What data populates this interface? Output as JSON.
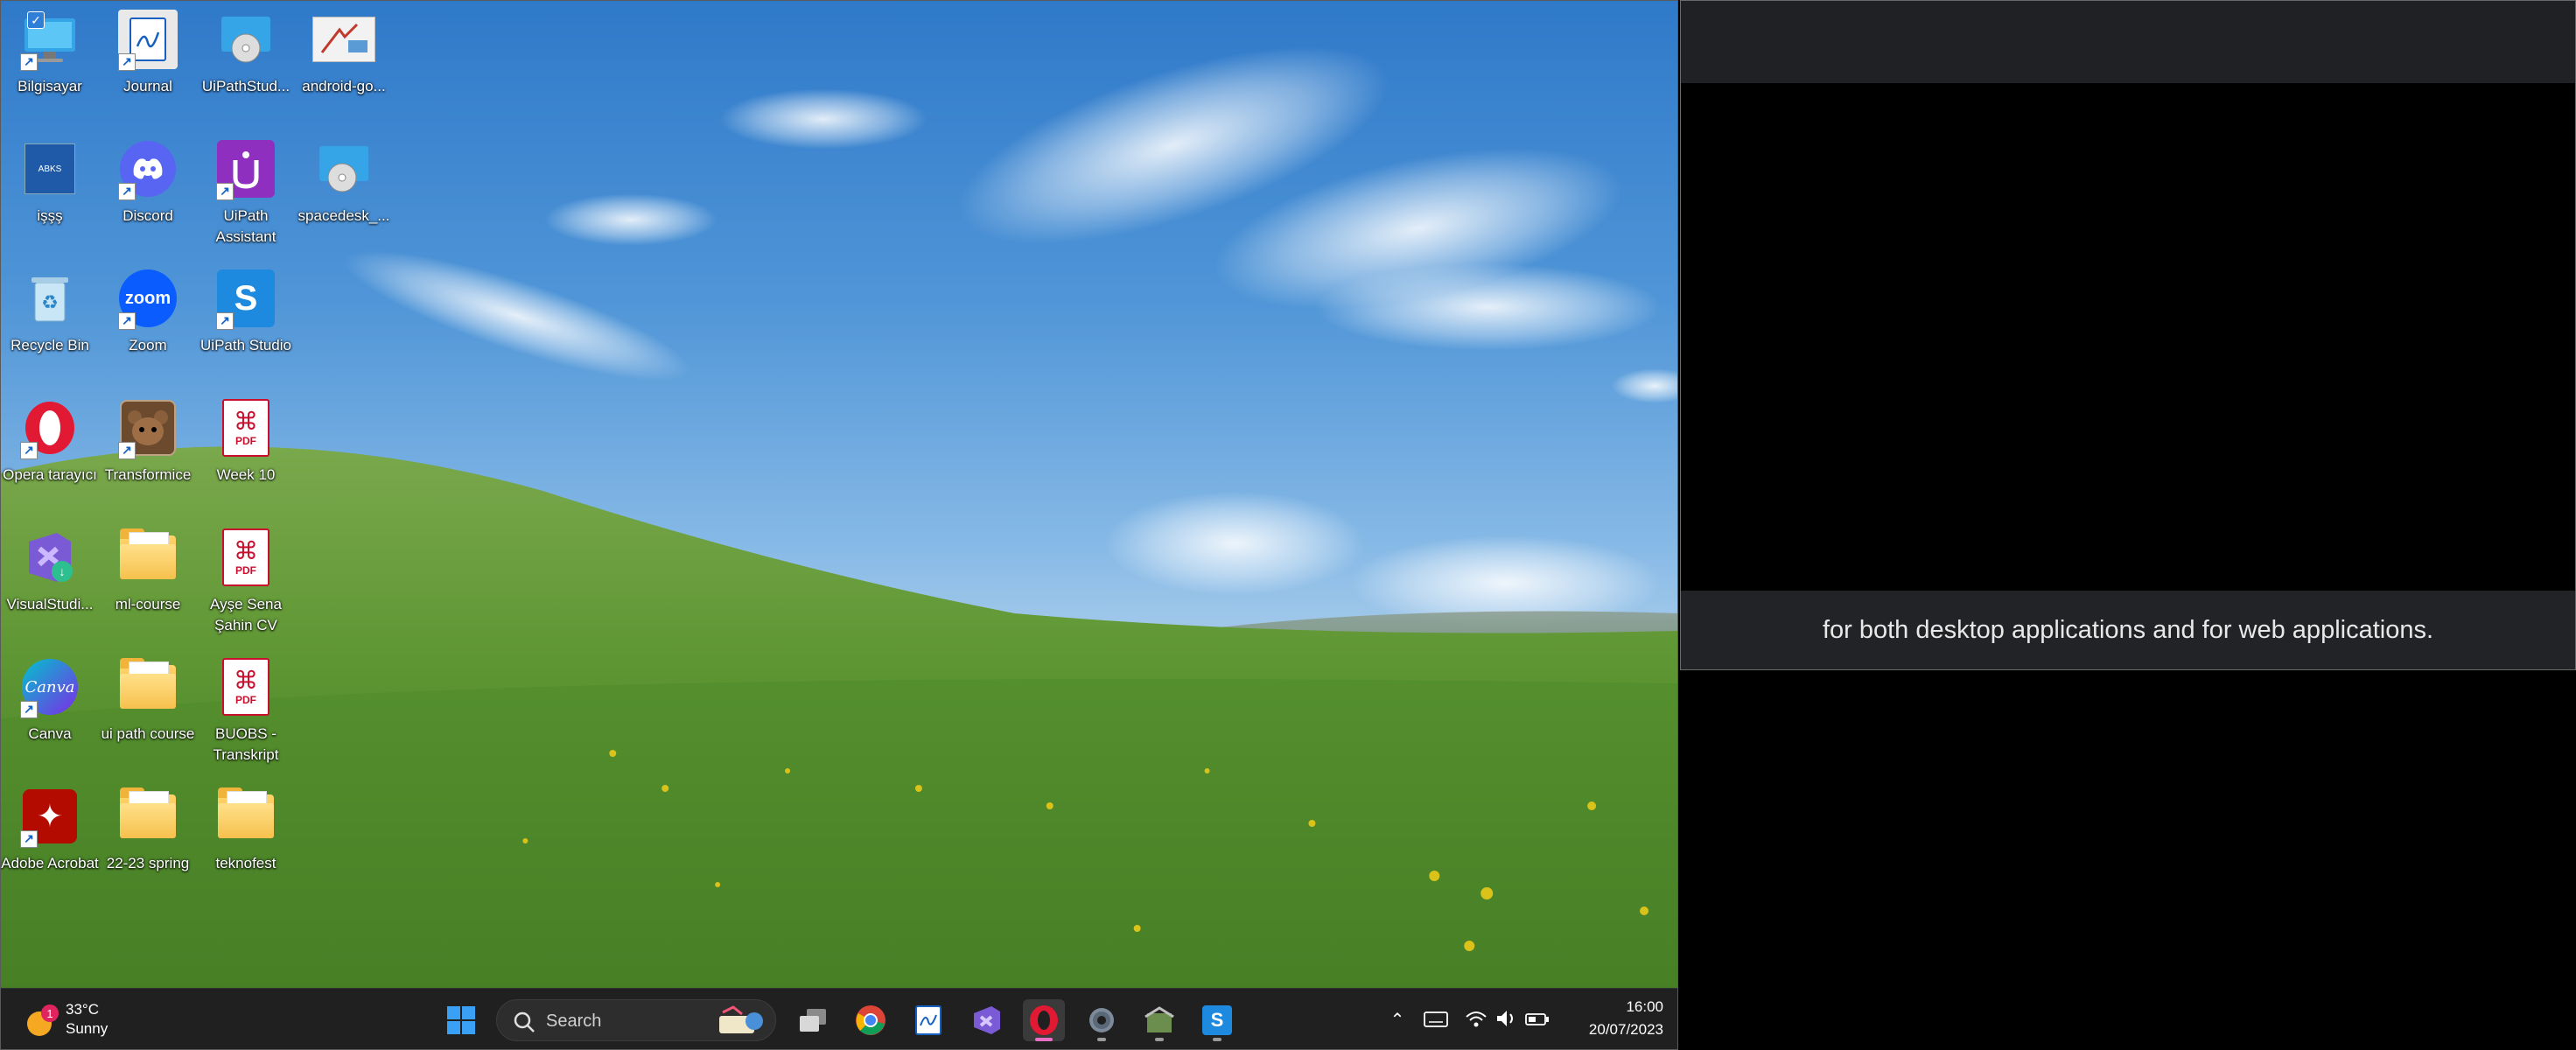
{
  "desktop": {
    "icons": [
      {
        "label": "Bilgisayar"
      },
      {
        "label": "Journal"
      },
      {
        "label": "UiPathStud..."
      },
      {
        "label": "android-go..."
      },
      {
        "label": "işşş"
      },
      {
        "label": "Discord"
      },
      {
        "label": "UiPath Assistant"
      },
      {
        "label": "spacedesk_..."
      },
      {
        "label": "Recycle Bin"
      },
      {
        "label": "Zoom"
      },
      {
        "label": "UiPath Studio"
      },
      {
        "label": "Opera tarayıcı"
      },
      {
        "label": "Transformice"
      },
      {
        "label": "Week 10"
      },
      {
        "label": "VisualStudi..."
      },
      {
        "label": "ml-course"
      },
      {
        "label": "Ayşe Sena Şahin CV"
      },
      {
        "label": "Canva"
      },
      {
        "label": "ui path course"
      },
      {
        "label": "BUOBS - Transkript"
      },
      {
        "label": "Adobe Acrobat"
      },
      {
        "label": "22-23 spring"
      },
      {
        "label": "teknofest"
      }
    ],
    "icon_texts": {
      "zoom": "zoom",
      "canva": "Canva",
      "pdf": "PDF",
      "abks": "ABKS"
    }
  },
  "taskbar": {
    "weather": {
      "temp": "33°C",
      "condition": "Sunny",
      "badge": "1"
    },
    "search_placeholder": "Search",
    "clock": {
      "time": "16:00",
      "date": "20/07/2023"
    }
  },
  "video_panel": {
    "caption": "for both desktop applications and for web applications."
  }
}
